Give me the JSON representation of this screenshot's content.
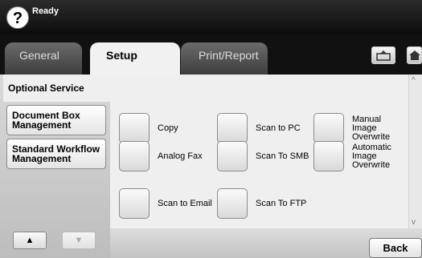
{
  "status": {
    "help_symbol": "?",
    "text": "Ready"
  },
  "tabs": [
    {
      "label": "General"
    },
    {
      "label": "Setup",
      "active": true
    },
    {
      "label": "Print/Report"
    }
  ],
  "header_icons": [
    "box-export-icon",
    "home-icon"
  ],
  "sidebar": {
    "items": [
      {
        "label": "Optional Service",
        "selected": true
      },
      {
        "label": "Document Box Management"
      },
      {
        "label": "Standard Workflow Management"
      }
    ],
    "nav_up": "▲",
    "nav_down": "▼"
  },
  "options": [
    {
      "label": "Copy"
    },
    {
      "label": "Scan to PC"
    },
    {
      "label": "Manual Image Overwrite"
    },
    {
      "label": "Analog Fax"
    },
    {
      "label": "Scan To SMB"
    },
    {
      "label": "Automatic Image Overwrite"
    },
    {
      "label": "Scan to Email"
    },
    {
      "label": "Scan To FTP"
    }
  ],
  "scrollbar": {
    "up": "^",
    "down": "v"
  },
  "footer": {
    "back_label": "Back"
  }
}
